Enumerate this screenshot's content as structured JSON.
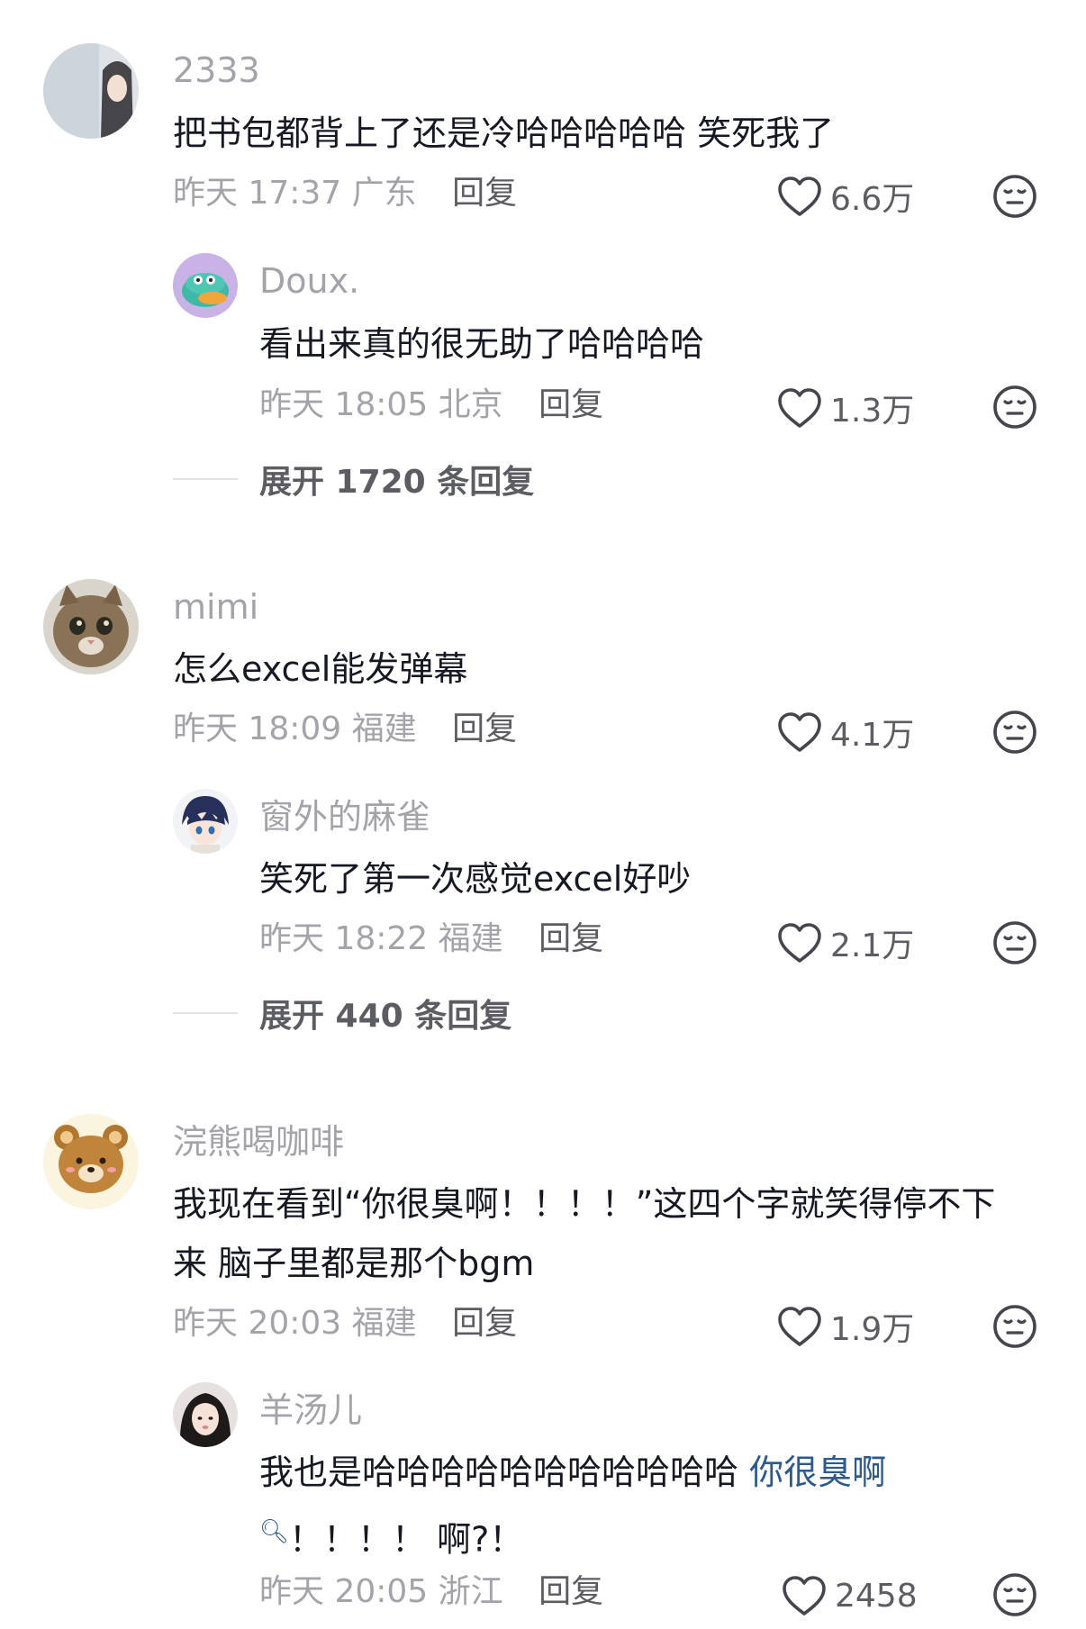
{
  "comments": [
    {
      "username": "2333",
      "lines": [
        "把书包都背上了还是冷哈哈哈哈哈 笑死我了"
      ],
      "time": "昨天 17:37",
      "location": "广东",
      "reply_label": "回复",
      "likes": "6.6万",
      "replies": [
        {
          "username": "Doux.",
          "lines": [
            "看出来真的很无助了哈哈哈哈"
          ],
          "time": "昨天 18:05",
          "location": "北京",
          "reply_label": "回复",
          "likes": "1.3万"
        }
      ],
      "expand_label": "展开 1720 条回复"
    },
    {
      "username": "mimi",
      "lines": [
        "怎么excel能发弹幕"
      ],
      "time": "昨天 18:09",
      "location": "福建",
      "reply_label": "回复",
      "likes": "4.1万",
      "replies": [
        {
          "username": "窗外的麻雀",
          "lines": [
            "笑死了第一次感觉excel好吵"
          ],
          "time": "昨天 18:22",
          "location": "福建",
          "reply_label": "回复",
          "likes": "2.1万"
        }
      ],
      "expand_label": "展开 440 条回复"
    },
    {
      "username": "浣熊喝咖啡",
      "lines": [
        "我现在看到“你很臭啊！！！！”这四个字就笑得停不下",
        "来 脑子里都是那个bgm"
      ],
      "time": "昨天 20:03",
      "location": "福建",
      "reply_label": "回复",
      "likes": "1.9万",
      "replies": [
        {
          "username": "羊汤儿",
          "lines": [
            "我也是哈哈哈哈哈哈哈哈哈哈哈 "
          ],
          "link_text": "你很臭啊",
          "line2": "！！！！ 啊?！",
          "time": "昨天 20:05",
          "location": "浙江",
          "reply_label": "回复",
          "likes": "2458"
        }
      ]
    }
  ],
  "icons": {
    "like": "heart-outline-icon",
    "dislike": "neutral-face-icon",
    "search": "search-icon"
  },
  "colors": {
    "text": "#161823",
    "muted": "#a3a4aa",
    "action": "#5c5d63",
    "link": "#2c5a8c"
  }
}
